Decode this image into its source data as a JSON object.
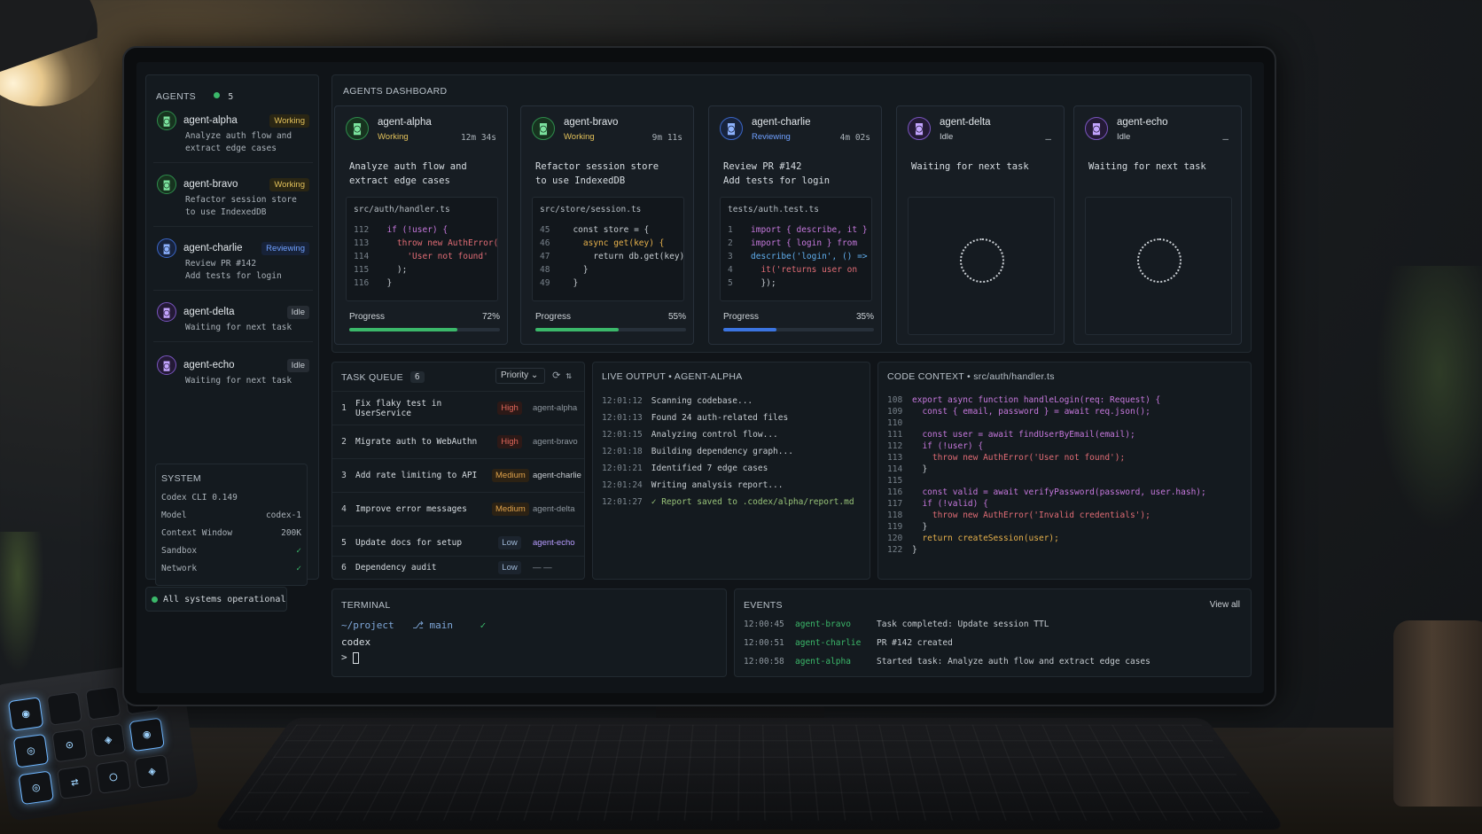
{
  "sidebar": {
    "title": "AGENTS",
    "count": "5",
    "agents": [
      {
        "name": "agent-alpha",
        "status": "Working",
        "task": "Analyze auth flow and\nextract edge cases"
      },
      {
        "name": "agent-bravo",
        "status": "Working",
        "task": "Refactor session store\nto use IndexedDB"
      },
      {
        "name": "agent-charlie",
        "status": "Reviewing",
        "task": "Review PR #142\nAdd tests for login"
      },
      {
        "name": "agent-delta",
        "status": "Idle",
        "task": "Waiting for next task"
      },
      {
        "name": "agent-echo",
        "status": "Idle",
        "task": "Waiting for next task"
      }
    ]
  },
  "system": {
    "title": "SYSTEM",
    "version": "Codex CLI 0.149",
    "model_label": "Model",
    "model_value": "codex-1",
    "context_label": "Context Window",
    "context_value": "200K",
    "sandbox_label": "Sandbox",
    "network_label": "Network",
    "status": "All systems operational"
  },
  "dashboard": {
    "title": "AGENTS DASHBOARD",
    "progress_label": "Progress",
    "cards": [
      {
        "name": "agent-alpha",
        "status": "Working",
        "time": "12m 34s",
        "desc": "Analyze auth flow and\nextract edge cases",
        "file": "src/auth/handler.ts",
        "progress": "72%",
        "progress_value": 0.72,
        "color": "#3bb86a"
      },
      {
        "name": "agent-bravo",
        "status": "Working",
        "time": "9m 11s",
        "desc": "Refactor session store\nto use IndexedDB",
        "file": "src/store/session.ts",
        "progress": "55%",
        "progress_value": 0.55,
        "color": "#3bb86a"
      },
      {
        "name": "agent-charlie",
        "status": "Reviewing",
        "time": "4m 02s",
        "desc": "Review PR #142\nAdd tests for login",
        "file": "tests/auth.test.ts",
        "progress": "35%",
        "progress_value": 0.35,
        "color": "#3b74e0"
      },
      {
        "name": "agent-delta",
        "status": "Idle",
        "time": "—",
        "desc": "Waiting for next task"
      },
      {
        "name": "agent-echo",
        "status": "Idle",
        "time": "—",
        "desc": "Waiting for next task"
      }
    ]
  },
  "snippets": {
    "alpha": [
      {
        "n": "112",
        "t": "  if (!user) {"
      },
      {
        "n": "113",
        "t": "    throw new AuthError("
      },
      {
        "n": "114",
        "t": "      'User not found'"
      },
      {
        "n": "115",
        "t": "    );"
      },
      {
        "n": "116",
        "t": "  }"
      }
    ],
    "bravo": [
      {
        "n": "45",
        "t": "  const store = {"
      },
      {
        "n": "46",
        "t": "    async get(key) {"
      },
      {
        "n": "47",
        "t": "      return db.get(key);"
      },
      {
        "n": "48",
        "t": "    }"
      },
      {
        "n": "49",
        "t": "  }"
      }
    ],
    "charlie": [
      {
        "n": "1",
        "t": "import { describe, it }"
      },
      {
        "n": "2",
        "t": "import { login } from"
      },
      {
        "n": "3",
        "t": "describe('login', () => {"
      },
      {
        "n": "4",
        "t": "  it('returns user on"
      },
      {
        "n": "5",
        "t": "  });"
      }
    ]
  },
  "tasks": {
    "title": "TASK QUEUE",
    "count": "6",
    "sort_label": "Priority",
    "items": [
      {
        "num": "1",
        "title": "Fix flaky test in UserService",
        "priority": "High",
        "owner": "agent-alpha"
      },
      {
        "num": "2",
        "title": "Migrate auth to WebAuthn",
        "priority": "High",
        "owner": "agent-bravo"
      },
      {
        "num": "3",
        "title": "Add rate limiting to API",
        "priority": "Medium",
        "owner": "agent-charlie"
      },
      {
        "num": "4",
        "title": "Improve error messages",
        "priority": "Medium",
        "owner": "agent-delta"
      },
      {
        "num": "5",
        "title": "Update docs for setup",
        "priority": "Low",
        "owner": "agent-echo"
      },
      {
        "num": "6",
        "title": "Dependency audit",
        "priority": "Low",
        "owner": "—   —"
      }
    ]
  },
  "live": {
    "title": "LIVE OUTPUT • AGENT-ALPHA",
    "lines": [
      {
        "ts": "12:01:12",
        "msg": "Scanning codebase..."
      },
      {
        "ts": "12:01:13",
        "msg": "Found 24 auth-related files"
      },
      {
        "ts": "12:01:15",
        "msg": "Analyzing control flow..."
      },
      {
        "ts": "12:01:18",
        "msg": "Building dependency graph..."
      },
      {
        "ts": "12:01:21",
        "msg": "Identified 7 edge cases"
      },
      {
        "ts": "12:01:24",
        "msg": "Writing analysis report..."
      },
      {
        "ts": "12:01:27",
        "msg": "✓ Report saved to .codex/alpha/report.md"
      }
    ]
  },
  "context": {
    "title": "CODE CONTEXT • src/auth/handler.ts",
    "lines": [
      {
        "n": "108",
        "t": "export async function handleLogin(req: Request) {"
      },
      {
        "n": "109",
        "t": "  const { email, password } = await req.json();"
      },
      {
        "n": "110",
        "t": ""
      },
      {
        "n": "111",
        "t": "  const user = await findUserByEmail(email);"
      },
      {
        "n": "112",
        "t": "  if (!user) {"
      },
      {
        "n": "113",
        "t": "    throw new AuthError('User not found');"
      },
      {
        "n": "114",
        "t": "  }"
      },
      {
        "n": "115",
        "t": ""
      },
      {
        "n": "116",
        "t": "  const valid = await verifyPassword(password, user.hash);"
      },
      {
        "n": "117",
        "t": "  if (!valid) {"
      },
      {
        "n": "118",
        "t": "    throw new AuthError('Invalid credentials');"
      },
      {
        "n": "119",
        "t": "  }"
      },
      {
        "n": "120",
        "t": "  return createSession(user);"
      },
      {
        "n": "122",
        "t": "}"
      }
    ]
  },
  "terminal": {
    "title": "TERMINAL",
    "path": "~/project",
    "branch": "main",
    "command": "codex",
    "prompt": ">"
  },
  "events": {
    "title": "EVENTS",
    "view_all": "View all",
    "items": [
      {
        "ts": "12:00:45",
        "agent": "agent-bravo",
        "msg": "Task completed: Update session TTL"
      },
      {
        "ts": "12:00:51",
        "agent": "agent-charlie",
        "msg": "PR #142 created"
      },
      {
        "ts": "12:00:58",
        "agent": "agent-alpha",
        "msg": "Started task: Analyze auth flow and extract edge cases"
      }
    ]
  },
  "icons": [
    "agent-icon",
    "check-icon",
    "chevron-down-icon",
    "refresh-icon",
    "filter-icon",
    "branch-icon",
    "spinner-icon"
  ]
}
